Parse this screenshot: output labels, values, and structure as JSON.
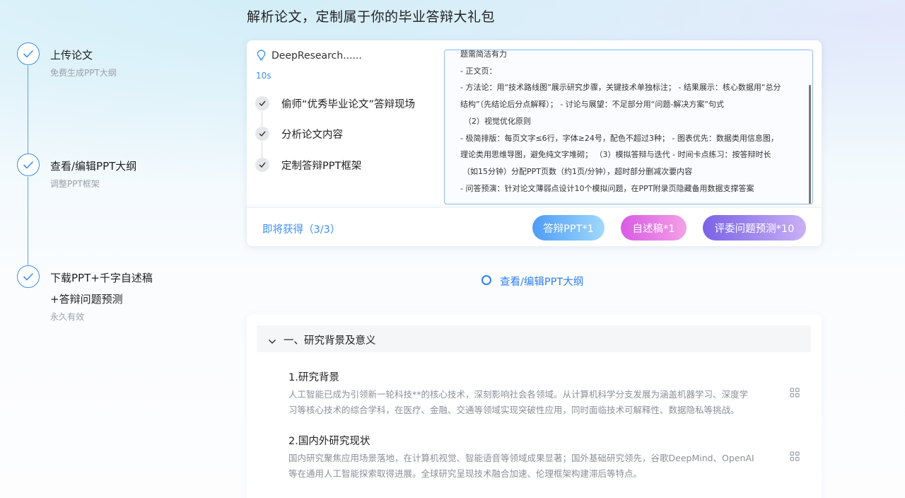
{
  "page": {
    "title": "解析论文，定制属于你的毕业答辩大礼包"
  },
  "steps": [
    {
      "title": "上传论文",
      "subtitle": "免费生成PPT大纲"
    },
    {
      "title": "查看/编辑PPT大纲",
      "subtitle": "调整PPT框架"
    },
    {
      "title_line1": "下载PPT+千字自述稿",
      "title_line2": "+答辩问题预测",
      "subtitle": "永久有效"
    }
  ],
  "research": {
    "title": "DeepResearch......",
    "elapsed": "10s",
    "icon": "bulb-icon",
    "tasks": [
      {
        "label": "偷师“优秀毕业论文”答辩现场"
      },
      {
        "label": "分析论文内容"
      },
      {
        "label": "定制答辩PPT框架"
      }
    ],
    "preview_lines": [
      "题需简洁有力",
      "- 正文页：",
      "- 方法论：用“技术路线图”展示研究步骤，关键技术单独标注；  - 结果展示：核心数据用“总分",
      "结构”（先结论后分点解释）；  - 讨论与展望：不足部分用“问题-解决方案”句式",
      "（2）视觉优化原则",
      "- 极简排版：每页文字≤6行，字体≥24号，配色不超过3种；  - 图表优先：数据类用信息图，",
      "理论类用思维导图，避免纯文字堆砌；   （3）模拟答辩与迭代 - 时间卡点练习：按答辩时长",
      "（如15分钟）分配PPT页数（约1页/分钟），超时部分删减次要内容",
      "- 问答预演：针对论文薄弱点设计10个模拟问题，在PPT附录页隐藏备用数据支撑答案"
    ]
  },
  "footer": {
    "label": "即将获得（3/3）",
    "buttons": [
      {
        "label": "答辩PPT*1"
      },
      {
        "label": "自述稿*1"
      },
      {
        "label": "评委问题预测*10"
      }
    ]
  },
  "status": {
    "label": "查看/编辑PPT大纲"
  },
  "outline": {
    "section_title": "一、研究背景及意义",
    "subsections": [
      {
        "title": "1.研究背景",
        "body_line1": "人工智能已成为引领新一轮科技**的核心技术，深刻影响社会各领域。从计算机科学分支发展为涵盖机器学习、深度学",
        "body_line2": "习等核心技术的综合学科，在医疗、金融、交通等领域实现突破性应用，同时面临技术可解释性、数据隐私等挑战。"
      },
      {
        "title": "2.国内外研究现状",
        "body_line1": "国内研究聚焦应用场景落地，在计算机视觉、智能语音等领域成果显著；国外基础研究领先，谷歌DeepMind、OpenAI",
        "body_line2": "等在通用人工智能探索取得进展。全球研究呈现技术融合加速、伦理框架构建滞后等特点。"
      }
    ]
  },
  "colors": {
    "accent": "#3d8ef0",
    "muted": "#9aa0a8"
  }
}
